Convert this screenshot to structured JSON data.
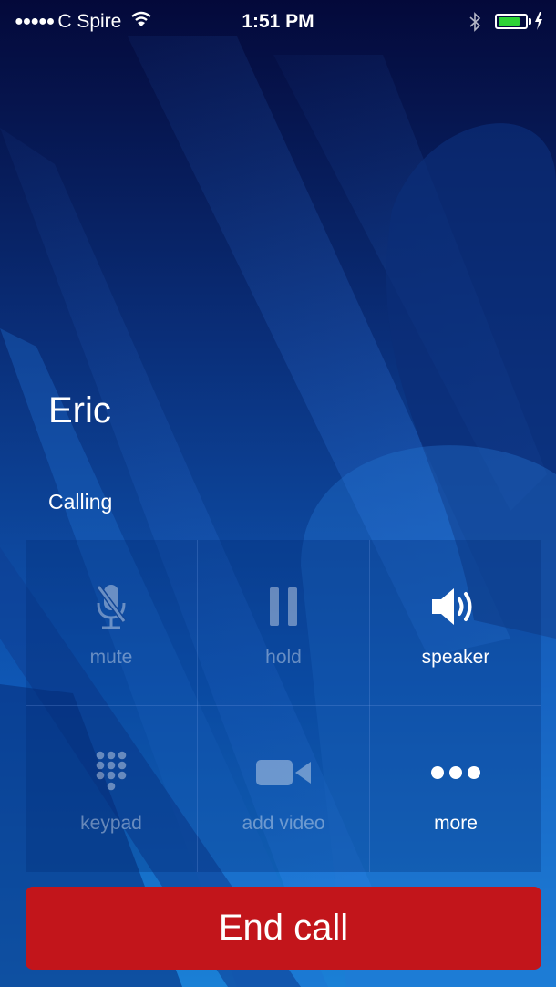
{
  "status_bar": {
    "carrier": "C Spire",
    "time": "1:51 PM",
    "battery_level": 0.85,
    "colors": {
      "battery": "#2ed336"
    }
  },
  "call": {
    "name": "Eric",
    "status": "Calling"
  },
  "controls": [
    {
      "label": "mute",
      "icon": "microphone-slash-icon",
      "enabled": false
    },
    {
      "label": "hold",
      "icon": "pause-icon",
      "enabled": false
    },
    {
      "label": "speaker",
      "icon": "speaker-icon",
      "enabled": true
    },
    {
      "label": "keypad",
      "icon": "keypad-icon",
      "enabled": false
    },
    {
      "label": "add video",
      "icon": "video-camera-icon",
      "enabled": false
    },
    {
      "label": "more",
      "icon": "more-icon",
      "enabled": true
    }
  ],
  "end_call": {
    "label": "End call",
    "color": "#c2151b"
  }
}
